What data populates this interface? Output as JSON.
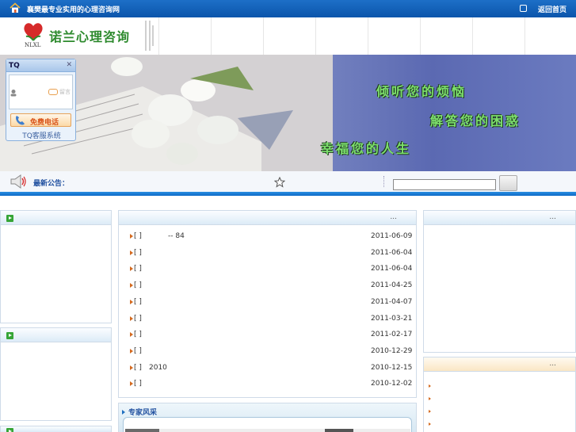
{
  "topbar": {
    "title": "襄樊最专业实用的心理咨询网",
    "back_home": "返回首页"
  },
  "logo": {
    "text": "诺兰心理咨询",
    "sub": "NLXL"
  },
  "banner": {
    "slogan_1": "倾听您的烦恼",
    "slogan_2": "解答您的困惑",
    "slogan_3": "幸福您的人生"
  },
  "tq": {
    "label": "TQ",
    "close": "⌘",
    "dim": "留言",
    "call": "免费电话",
    "system": "TQ客服系统"
  },
  "notice": {
    "label": "最新公告："
  },
  "news": {
    "more": "...",
    "items": [
      {
        "bracket": "[  ]",
        "title": "--  84",
        "date": "2011-06-09"
      },
      {
        "bracket": "[  ]",
        "title": "",
        "date": "2011-06-04"
      },
      {
        "bracket": "[  ]",
        "title": "",
        "date": "2011-06-04"
      },
      {
        "bracket": "[  ]",
        "title": "",
        "date": "2011-04-25"
      },
      {
        "bracket": "[  ]",
        "title": "",
        "date": "2011-04-07"
      },
      {
        "bracket": "[  ]",
        "title": "",
        "date": "2011-03-21"
      },
      {
        "bracket": "[  ]",
        "title": "",
        "date": "2011-02-17"
      },
      {
        "bracket": "[  ]",
        "title": "",
        "date": "2010-12-29"
      },
      {
        "bracket": "[  ]",
        "title": "2010",
        "date": "2010-12-15"
      },
      {
        "bracket": "[  ]",
        "title": "",
        "date": "2010-12-02"
      }
    ]
  },
  "expert": {
    "title": "专家风采"
  },
  "right_panels": {
    "top_more": "...",
    "bottom_more": "..."
  },
  "colors": {
    "topbar": "#0b55ab",
    "accent_green": "#2d8a2d",
    "slogan": "#7de06d",
    "date_arrow": "#d46a1f"
  }
}
